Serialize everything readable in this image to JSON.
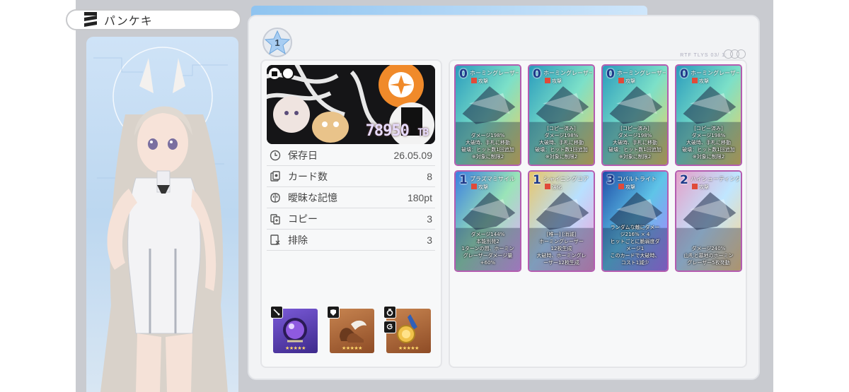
{
  "character": {
    "name": "パンケキ"
  },
  "deck": {
    "level": "1",
    "value_number": "78950",
    "value_unit": "TB",
    "header_code": "RTF TLYS 03/ 1:"
  },
  "stats": [
    {
      "icon": "clock-icon",
      "label": "保存日",
      "value": "26.05.09"
    },
    {
      "icon": "card-stack-icon",
      "label": "カード数",
      "value": "8"
    },
    {
      "icon": "brain-icon",
      "label": "曖昧な記憶",
      "value": "180pt"
    },
    {
      "icon": "copy-icon",
      "label": "コピー",
      "value": "3"
    },
    {
      "icon": "remove-icon",
      "label": "排除",
      "value": "3"
    }
  ],
  "items": [
    {
      "name": "purple-orb-item",
      "tag_icon": "sword-icon",
      "stars": "★★★★★",
      "color": "#6a4bc4"
    },
    {
      "name": "winged-boots-item",
      "tag_icon": "armor-icon",
      "stars": "★★★★★",
      "color": "#b46a3c"
    },
    {
      "name": "medal-item",
      "tag_icon": "ring-icon",
      "tag2_icon": "swirl-icon",
      "stars": "★★★★★",
      "color": "#b46a3c"
    }
  ],
  "cards": [
    {
      "cost": "0",
      "title": "ホーミングレーザー",
      "type": "攻撃",
      "desc": [
        "ダメージ198%",
        "大破時、手札に移動",
        "破壊：ヒット数1回追加",
        "※対象に制限2"
      ]
    },
    {
      "cost": "0",
      "title": "ホーミングレーザー",
      "type": "攻撃",
      "desc": [
        "[コピー済み]",
        "ダメージ198%",
        "大破時、手札に移動",
        "破壊：ヒット数1回追加",
        "※対象に制限2"
      ]
    },
    {
      "cost": "0",
      "title": "ホーミングレーザー",
      "type": "攻撃",
      "desc": [
        "[コピー済み]",
        "ダメージ198%",
        "大破時、手札に移動",
        "破壊：ヒット数1回追加",
        "※対象に制限2"
      ]
    },
    {
      "cost": "0",
      "title": "ホーミングレーザー",
      "type": "攻撃",
      "desc": [
        "[コピー済み]",
        "ダメージ198%",
        "大破時、手札に移動",
        "破壊：ヒット数1回追加",
        "※対象に制限2"
      ]
    },
    {
      "cost": "1",
      "title": "プラズマミサイル",
      "type": "攻撃",
      "desc": [
        "ダメージ144%",
        "本能別発2",
        "1ターンの間、ホーミン",
        "グレーザーダメージ量",
        "+60%"
      ]
    },
    {
      "cost": "1",
      "title": "シャイニングコア",
      "type": "強化",
      "desc": [
        "[唯一] [消滅]",
        "ホーミングレーザー",
        "12枚生成",
        "大破時、ホーミングレ",
        "ーザー12枚生成"
      ]
    },
    {
      "cost": "3",
      "title": "コバルトライト",
      "type": "攻撃",
      "desc": [
        "ランダムな敵にダメー",
        "ジ216% × 4",
        "ヒットごとに脆弱度ダ",
        "メージ1",
        "このカードで大破時、",
        "コスト1減少"
      ]
    },
    {
      "cost": "2",
      "title": "ハイシューティングスター",
      "type": "攻撃",
      "desc": [
        "ダメージ240%",
        "山札と墓地のホーミン",
        "グレーザー5枚発動"
      ]
    }
  ]
}
